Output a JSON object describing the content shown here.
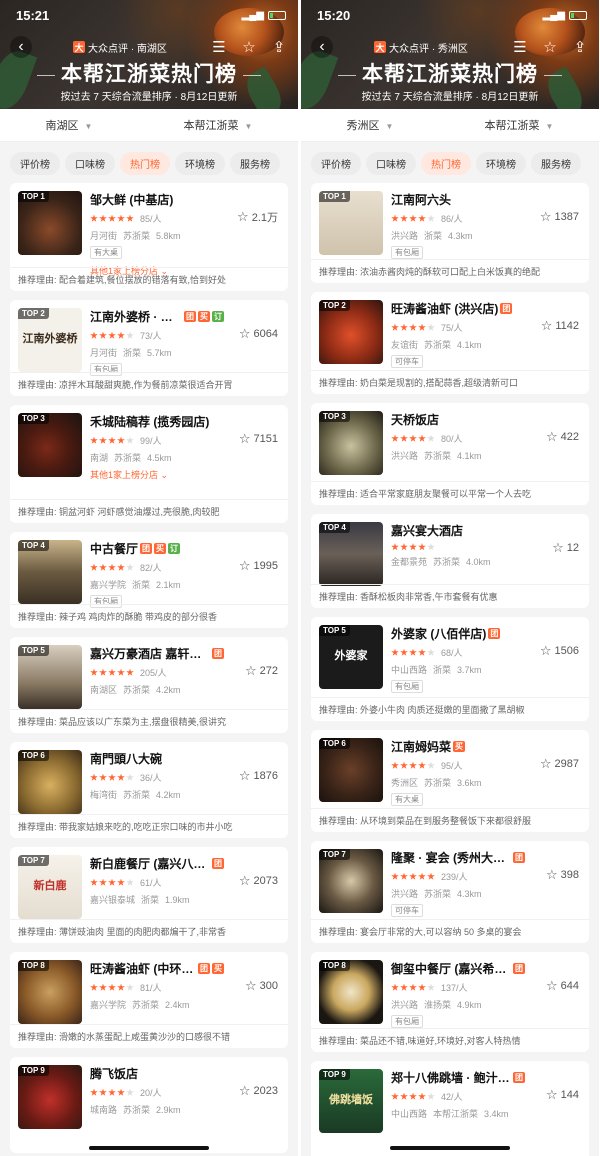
{
  "left": {
    "status": {
      "time": "15:21"
    },
    "header": {
      "brand": "大众点评 · 南湖区",
      "title": "本帮江浙菜热门榜",
      "subtitle": "按过去 7 天综合流量排序 · 8月12日更新"
    },
    "filters": [
      "南湖区",
      "本帮江浙菜"
    ],
    "tabs": [
      "评价榜",
      "口味榜",
      "热门榜",
      "环境榜",
      "服务榜"
    ],
    "active_tab": "热门榜",
    "items": [
      {
        "rank": "TOP 1",
        "name": "邹大鲜 (中基店)",
        "tags": [],
        "rating": 4.5,
        "price": "85/人",
        "area": "月河街",
        "cuisine": "苏浙菜",
        "dist": "5.8km",
        "chip": "有大桌",
        "more": "其他1家上榜分店",
        "fav": "2.1万",
        "reason": "推荐理由: 配合着建筑,餐位摆放的错落有致,恰到好处"
      },
      {
        "rank": "TOP 2",
        "name": "江南外婆桥 · 寻味...",
        "tags": [
          "团",
          "买",
          "订"
        ],
        "rating": 4,
        "price": "73/人",
        "area": "月河街",
        "cuisine": "浙菜",
        "dist": "5.7km",
        "chip": "有包厢",
        "more": "",
        "fav": "6064",
        "reason": "推荐理由: 凉拌木耳酸甜爽脆,作为餐前凉菜很适合开胃",
        "thumbtext": "江南外婆桥"
      },
      {
        "rank": "TOP 3",
        "name": "禾城陆稿荐 (揽秀园店)",
        "tags": [],
        "rating": 4,
        "price": "99/人",
        "area": "南湖",
        "cuisine": "苏浙菜",
        "dist": "4.5km",
        "chip": "",
        "more": "其他1家上榜分店",
        "fav": "7151",
        "reason": "推荐理由: 铜盆河虾 河虾感觉油爆过,壳很脆,肉较肥"
      },
      {
        "rank": "TOP 4",
        "name": "中古餐厅",
        "tags": [
          "团",
          "买",
          "订"
        ],
        "rating": 4,
        "price": "82/人",
        "area": "嘉兴学院",
        "cuisine": "浙菜",
        "dist": "2.1km",
        "chip": "有包厢",
        "more": "",
        "fav": "1995",
        "reason": "推荐理由: 辣子鸡 鸡肉炸的酥脆 带鸡皮的部分很香"
      },
      {
        "rank": "TOP 5",
        "name": "嘉兴万豪酒店 嘉轩阁 · ...",
        "tags": [
          "团"
        ],
        "rating": 5,
        "price": "205/人",
        "area": "南湖区",
        "cuisine": "苏浙菜",
        "dist": "4.2km",
        "chip": "",
        "more": "",
        "fav": "272",
        "reason": "推荐理由: 菜品应该以广东菜为主,摆盘很精美,很讲究"
      },
      {
        "rank": "TOP 6",
        "name": "南門頭八大碗",
        "tags": [],
        "rating": 4,
        "price": "36/人",
        "area": "梅湾街",
        "cuisine": "苏浙菜",
        "dist": "4.2km",
        "chip": "",
        "more": "",
        "fav": "1876",
        "reason": "推荐理由: 带我家姑娘来吃的,吃吃正宗口味的市井小吃"
      },
      {
        "rank": "TOP 7",
        "name": "新白鹿餐厅 (嘉兴八佰伴...",
        "tags": [
          "团"
        ],
        "rating": 4,
        "price": "61/人",
        "area": "嘉兴银泰城",
        "cuisine": "浙菜",
        "dist": "1.9km",
        "chip": "",
        "more": "",
        "fav": "2073",
        "reason": "推荐理由: 薄饼豉油肉 里面的肉肥肉都煸干了,非常香",
        "thumbtext": "新白鹿"
      },
      {
        "rank": "TOP 8",
        "name": "旺涛酱油虾 (中环店)",
        "tags": [
          "团",
          "买"
        ],
        "rating": 4,
        "price": "81/人",
        "area": "嘉兴学院",
        "cuisine": "苏浙菜",
        "dist": "2.4km",
        "chip": "",
        "more": "",
        "fav": "300",
        "reason": "推荐理由: 滑嫩的水蒸蛋配上咸蛋黄沙沙的口感很不错"
      },
      {
        "rank": "TOP 9",
        "name": "腾飞饭店",
        "tags": [],
        "rating": 4,
        "price": "20/人",
        "area": "城南路",
        "cuisine": "苏浙菜",
        "dist": "2.9km",
        "chip": "",
        "more": "",
        "fav": "2023",
        "reason": ""
      }
    ]
  },
  "right": {
    "status": {
      "time": "15:20"
    },
    "header": {
      "brand": "大众点评 · 秀洲区",
      "title": "本帮江浙菜热门榜",
      "subtitle": "按过去 7 天综合流量排序 · 8月12日更新"
    },
    "filters": [
      "秀洲区",
      "本帮江浙菜"
    ],
    "tabs": [
      "评价榜",
      "口味榜",
      "热门榜",
      "环境榜",
      "服务榜"
    ],
    "active_tab": "热门榜",
    "items": [
      {
        "rank": "TOP 1",
        "name": "江南阿六头",
        "tags": [],
        "rating": 4,
        "price": "86/人",
        "area": "洪兴路",
        "cuisine": "浙菜",
        "dist": "4.3km",
        "chip": "有包厢",
        "fav": "1387",
        "reason": "推荐理由: 浓油赤酱肉炖的酥软可口配上白米饭真的绝配"
      },
      {
        "rank": "TOP 2",
        "name": "旺涛酱油虾 (洪兴店)",
        "tags": [
          "团"
        ],
        "rating": 4,
        "price": "75/人",
        "area": "友谊街",
        "cuisine": "苏浙菜",
        "dist": "4.1km",
        "chip": "可停车",
        "fav": "1142",
        "reason": "推荐理由: 奶白菜是现割的,搭配蒜香,超级清新可口"
      },
      {
        "rank": "TOP 3",
        "name": "天桥饭店",
        "tags": [],
        "rating": 3.5,
        "price": "80/人",
        "area": "洪兴路",
        "cuisine": "苏浙菜",
        "dist": "4.1km",
        "chip": "",
        "fav": "422",
        "reason": "推荐理由: 适合平常家庭朋友聚餐可以平常一个人去吃"
      },
      {
        "rank": "TOP 4",
        "name": "嘉兴宴大酒店",
        "tags": [],
        "rating": 3.5,
        "price": "",
        "area": "金都景苑",
        "cuisine": "苏浙菜",
        "dist": "4.0km",
        "chip": "",
        "fav": "12",
        "reason": "推荐理由: 香酥松板肉非常香,午市套餐有优惠"
      },
      {
        "rank": "TOP 5",
        "name": "外婆家 (八佰伴店)",
        "tags": [
          "团"
        ],
        "rating": 4,
        "price": "68/人",
        "area": "中山西路",
        "cuisine": "浙菜",
        "dist": "3.7km",
        "chip": "有包厢",
        "fav": "1506",
        "reason": "推荐理由: 外婆小牛肉 肉质还挺嫩的里面撒了黑胡椒",
        "thumbtext": "外婆家"
      },
      {
        "rank": "TOP 6",
        "name": "江南姆妈菜",
        "tags": [
          "买"
        ],
        "rating": 4,
        "price": "95/人",
        "area": "秀洲区",
        "cuisine": "苏浙菜",
        "dist": "3.6km",
        "chip": "有大桌",
        "fav": "2987",
        "reason": "推荐理由: 从环境到菜品在到服务整餐饭下来都很舒服"
      },
      {
        "rank": "TOP 7",
        "name": "隆聚 · 宴会 (秀州大道店)",
        "tags": [
          "团"
        ],
        "rating": 5,
        "price": "239/人",
        "area": "洪兴路",
        "cuisine": "苏浙菜",
        "dist": "4.3km",
        "chip": "可停车",
        "fav": "398",
        "reason": "推荐理由: 宴会厅非常的大,可以容纳 50 多桌的宴会"
      },
      {
        "rank": "TOP 8",
        "name": "御玺中餐厅 (嘉兴希尔顿...",
        "tags": [
          "团"
        ],
        "rating": 4,
        "price": "137/人",
        "area": "洪兴路",
        "cuisine": "淮扬菜",
        "dist": "4.9km",
        "chip": "有包厢",
        "fav": "644",
        "reason": "推荐理由: 菜品还不错,味道好,环境好,对客人特热情"
      },
      {
        "rank": "TOP 9",
        "name": "郑十八佛跳墙 · 鲍汁捞饭...",
        "tags": [
          "团"
        ],
        "rating": 4,
        "price": "42/人",
        "area": "中山西路",
        "cuisine": "本帮江浙菜",
        "dist": "3.4km",
        "chip": "",
        "fav": "144",
        "reason": "",
        "thumbtext": "佛跳墙饭"
      }
    ]
  },
  "icons": {
    "back": "chevron-left-icon",
    "list": "list-icon",
    "favorite": "star-icon",
    "share": "share-icon"
  },
  "colors": {
    "accent": "#ff6633",
    "ding": "#58b04a"
  }
}
